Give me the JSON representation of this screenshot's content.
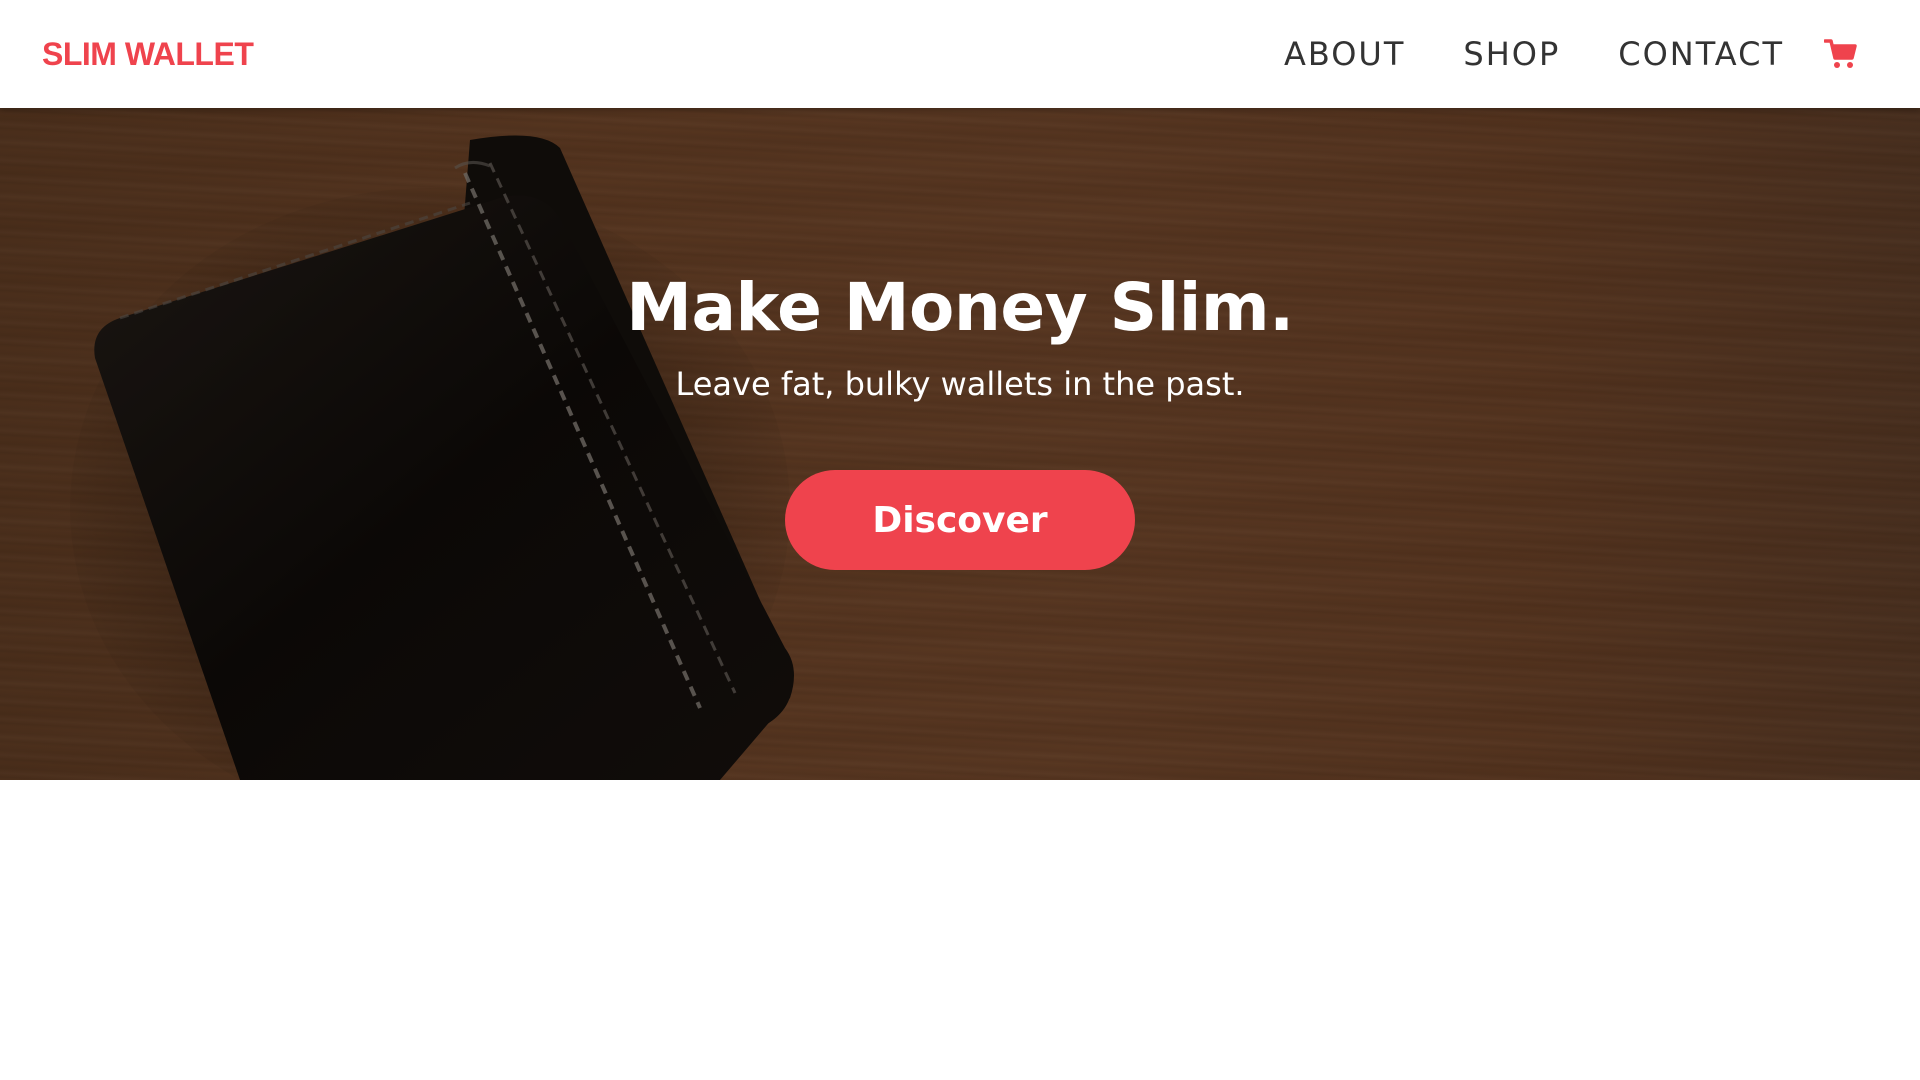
{
  "nav": {
    "brand": "SLIM WALLET",
    "links": [
      "ABOUT",
      "SHOP",
      "CONTACT"
    ],
    "cart_icon": "shopping-cart-icon"
  },
  "hero": {
    "title": "Make Money Slim.",
    "subtitle": "Leave fat, bulky wallets in the past.",
    "button_label": "Discover",
    "image": "leather-wallet-on-wooden-table"
  },
  "colors": {
    "accent": "#ef434d",
    "nav_text": "#333333",
    "hero_text": "#ffffff"
  }
}
